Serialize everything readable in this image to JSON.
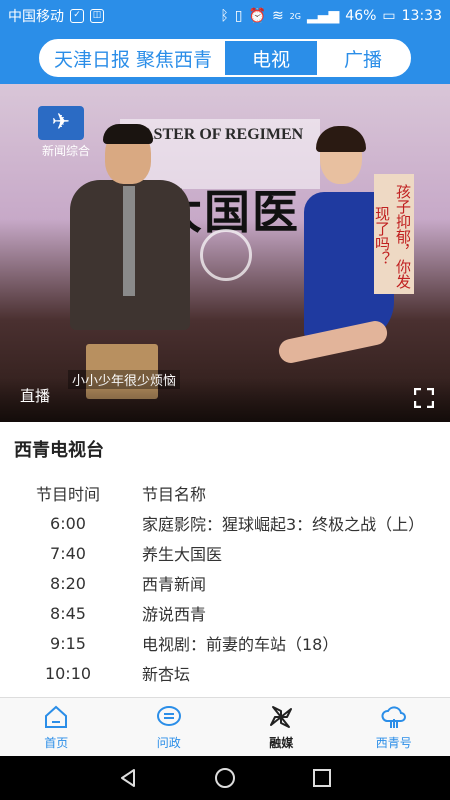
{
  "status_bar": {
    "carrier": "中国移动",
    "network": "2G",
    "battery": "46%",
    "time": "13:33"
  },
  "header": {
    "tabs": [
      {
        "label": "天津日报  聚焦西青",
        "active": false
      },
      {
        "label": "电视",
        "active": true
      },
      {
        "label": "广播",
        "active": false
      }
    ]
  },
  "video": {
    "channel_label": "新闻综合",
    "show_title_en": "ASTER OF REGIMEN",
    "show_title_cn": "大国医",
    "side_banner": "孩子抑郁，你发现了吗？",
    "subtitle": "小小少年很少烦恼",
    "live_label": "直播",
    "fullscreen_icon": "fullscreen-icon"
  },
  "schedule": {
    "station": "西青电视台",
    "header_time": "节目时间",
    "header_name": "节目名称",
    "items": [
      {
        "time": "6:00",
        "name": "家庭影院：猩球崛起3：终极之战（上）"
      },
      {
        "time": "7:40",
        "name": "养生大国医"
      },
      {
        "time": "8:20",
        "name": "西青新闻"
      },
      {
        "time": "8:45",
        "name": "游说西青"
      },
      {
        "time": "9:15",
        "name": "电视剧：前妻的车站（18）"
      },
      {
        "time": "10:10",
        "name": "新杏坛"
      }
    ]
  },
  "bottom_nav": {
    "items": [
      {
        "label": "首页",
        "icon": "home-icon",
        "active": false
      },
      {
        "label": "问政",
        "icon": "chat-icon",
        "active": false
      },
      {
        "label": "融媒",
        "icon": "pinwheel-icon",
        "active": true
      },
      {
        "label": "西青号",
        "icon": "cloud-icon",
        "active": false
      }
    ]
  },
  "colors": {
    "brand": "#2b8ee8",
    "text": "#333333"
  }
}
